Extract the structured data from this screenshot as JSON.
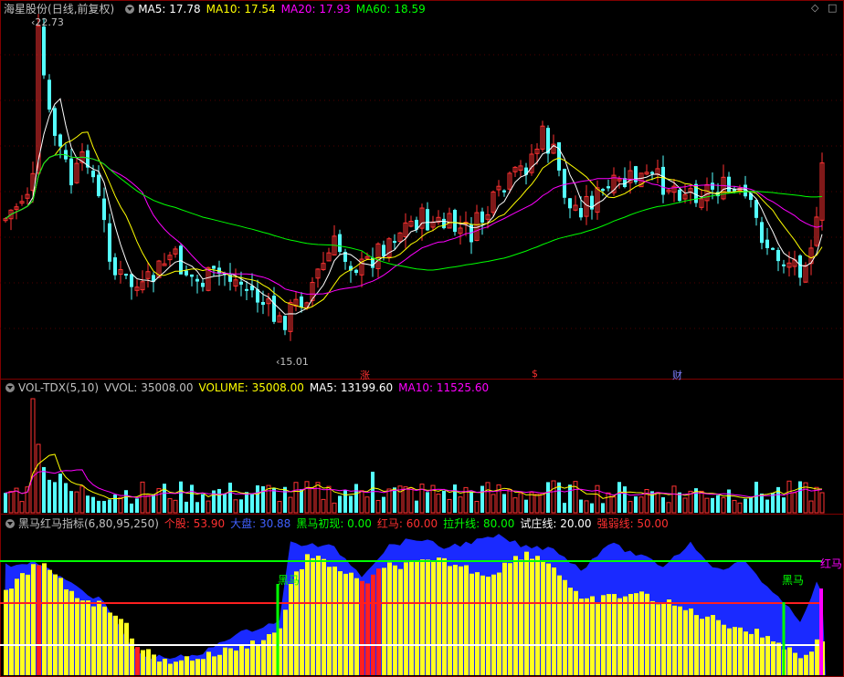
{
  "price_panel": {
    "stock_name": "海星股份",
    "period_label": "(日线,前复权)",
    "ma_labels": [
      {
        "text": "MA5: 17.78",
        "color": "#ffffff"
      },
      {
        "text": "MA10: 17.54",
        "color": "#ffff00"
      },
      {
        "text": "MA20: 17.93",
        "color": "#ff00ff"
      },
      {
        "text": "MA60: 18.59",
        "color": "#00ff00"
      }
    ],
    "high_label": "22.73",
    "low_label": "15.01",
    "event_markers": [
      {
        "text": "涨",
        "color": "#ff3030"
      },
      {
        "text": "$",
        "color": "#ff3030"
      },
      {
        "text": "财",
        "color": "#8080ff"
      }
    ]
  },
  "volume_panel": {
    "indicator_name": "VOL-TDX(5,10)",
    "labels": [
      {
        "text": "VVOL: 35008.00",
        "color": "#c0c0c0"
      },
      {
        "text": "VOLUME: 35008.00",
        "color": "#ffff00"
      },
      {
        "text": "MA5: 13199.60",
        "color": "#ffffff"
      },
      {
        "text": "MA10: 11525.60",
        "color": "#ff00ff"
      }
    ]
  },
  "indicator_panel": {
    "indicator_name": "黑马红马指标(6,80,95,250)",
    "labels": [
      {
        "text": "个股: 53.90",
        "color": "#ff3030"
      },
      {
        "text": "大盘: 30.88",
        "color": "#4060ff"
      },
      {
        "text": "黑马初现: 0.00",
        "color": "#00ff00"
      },
      {
        "text": "红马: 60.00",
        "color": "#ff3030"
      },
      {
        "text": "拉升线: 80.00",
        "color": "#00ff00"
      },
      {
        "text": "试庄线: 20.00",
        "color": "#ffffff"
      },
      {
        "text": "强弱线: 50.00",
        "color": "#ff3030"
      }
    ],
    "signal_labels": [
      "黑马",
      "黑马",
      "红马"
    ]
  },
  "icons": [
    "chevron-down-icon",
    "diamond-icon",
    "square-icon"
  ],
  "colors": {
    "up": "#ff3232",
    "down": "#54ffff",
    "background": "#000000"
  }
}
